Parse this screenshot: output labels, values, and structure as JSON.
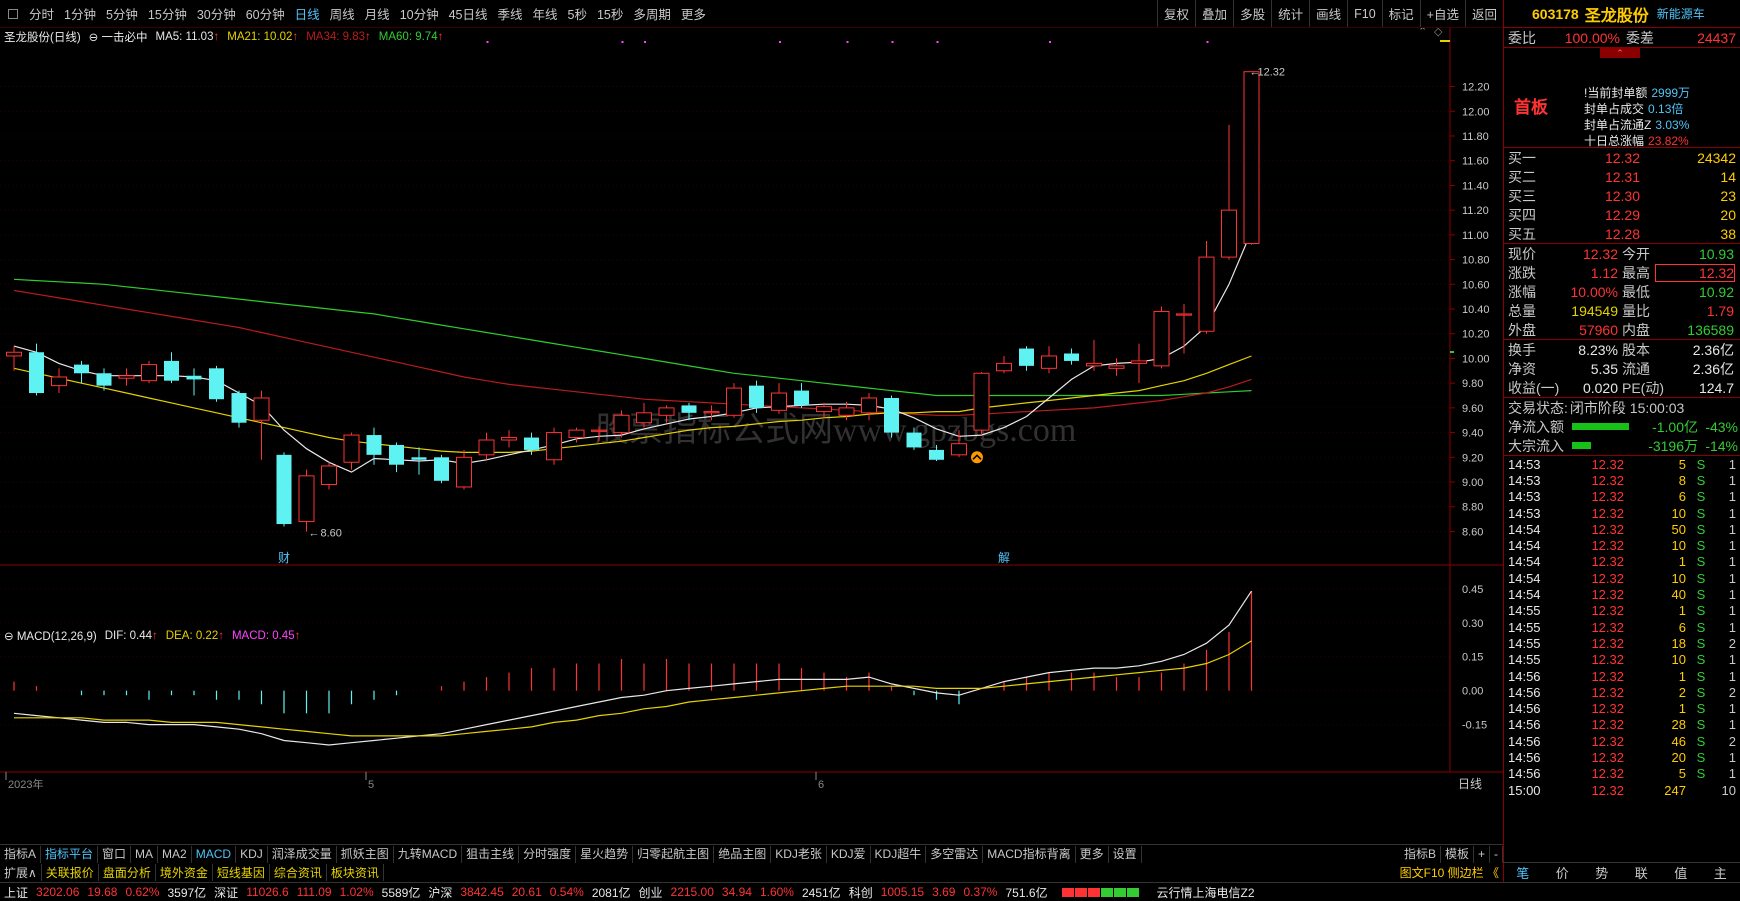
{
  "toolbar": {
    "timeframes": [
      "分时",
      "1分钟",
      "5分钟",
      "15分钟",
      "30分钟",
      "60分钟",
      "日线",
      "周线",
      "月线",
      "10分钟",
      "45日线",
      "季线",
      "年线",
      "5秒",
      "15秒",
      "多周期",
      "更多"
    ],
    "active_index": 6,
    "right_tools": [
      "复权",
      "叠加",
      "多股",
      "统计",
      "画线",
      "F10",
      "标记",
      "+自选",
      "返回"
    ]
  },
  "chart_info": {
    "title": "圣龙股份(日线)",
    "indicator": "一击必中",
    "ma5": "MA5: 11.03",
    "ma21": "MA21: 10.02",
    "ma34": "MA34: 9.83",
    "ma60": "MA60: 9.74"
  },
  "macd_info": {
    "title": "MACD(12,26,9)",
    "dif": "DIF: 0.44",
    "dea": "DEA: 0.22",
    "macd": "MACD: 0.45"
  },
  "chart_data": {
    "type": "candlestick",
    "price_axis": {
      "min": 8.45,
      "max": 12.35,
      "ticks": [
        8.6,
        8.8,
        9.0,
        9.2,
        9.4,
        9.6,
        9.8,
        10.0,
        10.2,
        10.4,
        10.6,
        10.8,
        11.0,
        11.2,
        11.4,
        11.6,
        11.8,
        12.0,
        12.2
      ]
    },
    "candles": [
      {
        "o": 10.02,
        "c": 10.05,
        "h": 10.1,
        "l": 9.9
      },
      {
        "o": 10.05,
        "c": 9.72,
        "h": 10.12,
        "l": 9.7
      },
      {
        "o": 9.78,
        "c": 9.85,
        "h": 9.92,
        "l": 9.72
      },
      {
        "o": 9.95,
        "c": 9.88,
        "h": 9.98,
        "l": 9.8
      },
      {
        "o": 9.88,
        "c": 9.78,
        "h": 9.92,
        "l": 9.74
      },
      {
        "o": 9.84,
        "c": 9.86,
        "h": 9.92,
        "l": 9.78
      },
      {
        "o": 9.82,
        "c": 9.95,
        "h": 9.98,
        "l": 9.8
      },
      {
        "o": 9.98,
        "c": 9.82,
        "h": 10.05,
        "l": 9.8
      },
      {
        "o": 9.86,
        "c": 9.83,
        "h": 9.92,
        "l": 9.7
      },
      {
        "o": 9.92,
        "c": 9.67,
        "h": 9.94,
        "l": 9.65
      },
      {
        "o": 9.72,
        "c": 9.48,
        "h": 9.74,
        "l": 9.44
      },
      {
        "o": 9.5,
        "c": 9.68,
        "h": 9.74,
        "l": 9.18
      },
      {
        "o": 9.22,
        "c": 8.66,
        "h": 9.24,
        "l": 8.64
      },
      {
        "o": 8.68,
        "c": 9.05,
        "h": 9.1,
        "l": 8.6
      },
      {
        "o": 8.98,
        "c": 9.13,
        "h": 9.16,
        "l": 8.94
      },
      {
        "o": 9.16,
        "c": 9.38,
        "h": 9.4,
        "l": 9.1
      },
      {
        "o": 9.38,
        "c": 9.22,
        "h": 9.44,
        "l": 9.14
      },
      {
        "o": 9.3,
        "c": 9.14,
        "h": 9.32,
        "l": 9.08
      },
      {
        "o": 9.2,
        "c": 9.18,
        "h": 9.28,
        "l": 9.06
      },
      {
        "o": 9.2,
        "c": 9.01,
        "h": 9.22,
        "l": 8.99
      },
      {
        "o": 8.96,
        "c": 9.2,
        "h": 9.26,
        "l": 8.94
      },
      {
        "o": 9.22,
        "c": 9.34,
        "h": 9.4,
        "l": 9.18
      },
      {
        "o": 9.34,
        "c": 9.36,
        "h": 9.42,
        "l": 9.28
      },
      {
        "o": 9.36,
        "c": 9.26,
        "h": 9.4,
        "l": 9.22
      },
      {
        "o": 9.18,
        "c": 9.4,
        "h": 9.44,
        "l": 9.14
      },
      {
        "o": 9.36,
        "c": 9.42,
        "h": 9.44,
        "l": 9.32
      },
      {
        "o": 9.42,
        "c": 9.42,
        "h": 9.45,
        "l": 9.33
      },
      {
        "o": 9.4,
        "c": 9.54,
        "h": 9.58,
        "l": 9.36
      },
      {
        "o": 9.48,
        "c": 9.56,
        "h": 9.64,
        "l": 9.44
      },
      {
        "o": 9.54,
        "c": 9.6,
        "h": 9.62,
        "l": 9.48
      },
      {
        "o": 9.62,
        "c": 9.56,
        "h": 9.64,
        "l": 9.5
      },
      {
        "o": 9.56,
        "c": 9.57,
        "h": 9.62,
        "l": 9.5
      },
      {
        "o": 9.54,
        "c": 9.76,
        "h": 9.8,
        "l": 9.52
      },
      {
        "o": 9.78,
        "c": 9.6,
        "h": 9.82,
        "l": 9.56
      },
      {
        "o": 9.58,
        "c": 9.72,
        "h": 9.8,
        "l": 9.55
      },
      {
        "o": 9.74,
        "c": 9.62,
        "h": 9.8,
        "l": 9.6
      },
      {
        "o": 9.57,
        "c": 9.61,
        "h": 9.64,
        "l": 9.52
      },
      {
        "o": 9.54,
        "c": 9.6,
        "h": 9.65,
        "l": 9.5
      },
      {
        "o": 9.56,
        "c": 9.68,
        "h": 9.72,
        "l": 9.5
      },
      {
        "o": 9.68,
        "c": 9.4,
        "h": 9.7,
        "l": 9.36
      },
      {
        "o": 9.4,
        "c": 9.28,
        "h": 9.44,
        "l": 9.26
      },
      {
        "o": 9.26,
        "c": 9.18,
        "h": 9.3,
        "l": 9.17
      },
      {
        "o": 9.22,
        "c": 9.31,
        "h": 9.42,
        "l": 9.2
      },
      {
        "o": 9.42,
        "c": 9.88,
        "h": 9.89,
        "l": 9.38
      },
      {
        "o": 9.9,
        "c": 9.96,
        "h": 10.02,
        "l": 9.88
      },
      {
        "o": 10.08,
        "c": 9.94,
        "h": 10.1,
        "l": 9.9
      },
      {
        "o": 9.92,
        "c": 10.02,
        "h": 10.1,
        "l": 9.88
      },
      {
        "o": 10.04,
        "c": 9.98,
        "h": 10.08,
        "l": 9.95
      },
      {
        "o": 9.94,
        "c": 9.96,
        "h": 10.15,
        "l": 9.9
      },
      {
        "o": 9.92,
        "c": 9.94,
        "h": 10.0,
        "l": 9.86
      },
      {
        "o": 9.96,
        "c": 9.98,
        "h": 10.12,
        "l": 9.8
      },
      {
        "o": 9.94,
        "c": 10.38,
        "h": 10.42,
        "l": 9.92
      },
      {
        "o": 10.36,
        "c": 10.36,
        "h": 10.44,
        "l": 10.04
      },
      {
        "o": 10.22,
        "c": 10.82,
        "h": 10.95,
        "l": 10.2
      },
      {
        "o": 10.82,
        "c": 11.2,
        "h": 11.89,
        "l": 10.8
      },
      {
        "o": 10.93,
        "c": 12.32,
        "h": 12.32,
        "l": 10.92
      }
    ],
    "ma5": [
      10.1,
      10.05,
      9.96,
      9.9,
      9.86,
      9.86,
      9.86,
      9.86,
      9.85,
      9.82,
      9.72,
      9.62,
      9.42,
      9.27,
      9.16,
      9.08,
      9.19,
      9.18,
      9.17,
      9.18,
      9.15,
      9.18,
      9.22,
      9.26,
      9.3,
      9.35,
      9.37,
      9.38,
      9.43,
      9.47,
      9.51,
      9.53,
      9.56,
      9.6,
      9.61,
      9.62,
      9.63,
      9.63,
      9.62,
      9.59,
      9.52,
      9.43,
      9.37,
      9.38,
      9.44,
      9.53,
      9.68,
      9.83,
      9.94,
      9.96,
      9.97,
      10.0,
      10.1,
      10.26,
      10.6,
      11.03
    ],
    "ma21": [
      9.92,
      9.88,
      9.84,
      9.8,
      9.76,
      9.72,
      9.68,
      9.64,
      9.6,
      9.56,
      9.52,
      9.48,
      9.44,
      9.4,
      9.36,
      9.33,
      9.31,
      9.29,
      9.27,
      9.25,
      9.24,
      9.24,
      9.24,
      9.25,
      9.27,
      9.29,
      9.31,
      9.33,
      9.36,
      9.39,
      9.42,
      9.44,
      9.45,
      9.47,
      9.49,
      9.5,
      9.52,
      9.53,
      9.55,
      9.56,
      9.56,
      9.57,
      9.57,
      9.6,
      9.62,
      9.64,
      9.66,
      9.68,
      9.7,
      9.72,
      9.74,
      9.78,
      9.82,
      9.88,
      9.95,
      10.02
    ],
    "ma34": [
      10.55,
      10.52,
      10.49,
      10.46,
      10.43,
      10.4,
      10.37,
      10.34,
      10.31,
      10.28,
      10.25,
      10.21,
      10.17,
      10.13,
      10.09,
      10.05,
      10.01,
      9.97,
      9.93,
      9.89,
      9.85,
      9.82,
      9.79,
      9.77,
      9.75,
      9.73,
      9.71,
      9.69,
      9.67,
      9.66,
      9.65,
      9.64,
      9.63,
      9.62,
      9.61,
      9.6,
      9.59,
      9.58,
      9.57,
      9.56,
      9.55,
      9.54,
      9.54,
      9.55,
      9.56,
      9.57,
      9.58,
      9.59,
      9.6,
      9.62,
      9.64,
      9.66,
      9.69,
      9.72,
      9.77,
      9.83
    ],
    "ma60": [
      10.64,
      10.63,
      10.62,
      10.61,
      10.6,
      10.58,
      10.56,
      10.54,
      10.52,
      10.5,
      10.48,
      10.46,
      10.44,
      10.42,
      10.4,
      10.38,
      10.36,
      10.33,
      10.3,
      10.27,
      10.24,
      10.21,
      10.18,
      10.15,
      10.12,
      10.09,
      10.06,
      10.03,
      10.0,
      9.97,
      9.94,
      9.91,
      9.88,
      9.86,
      9.84,
      9.82,
      9.8,
      9.78,
      9.76,
      9.74,
      9.72,
      9.7,
      9.7,
      9.7,
      9.7,
      9.7,
      9.7,
      9.7,
      9.7,
      9.7,
      9.7,
      9.7,
      9.71,
      9.72,
      9.73,
      9.74
    ],
    "macd_axis": {
      "min": -0.24,
      "max": 0.52,
      "ticks": [
        -0.15,
        0.0,
        0.15,
        0.3,
        0.45
      ]
    },
    "dif": [
      -0.1,
      -0.11,
      -0.12,
      -0.13,
      -0.14,
      -0.14,
      -0.15,
      -0.15,
      -0.15,
      -0.16,
      -0.17,
      -0.19,
      -0.22,
      -0.23,
      -0.24,
      -0.23,
      -0.22,
      -0.21,
      -0.2,
      -0.19,
      -0.17,
      -0.15,
      -0.13,
      -0.11,
      -0.09,
      -0.07,
      -0.05,
      -0.03,
      -0.02,
      0.0,
      0.01,
      0.02,
      0.03,
      0.04,
      0.05,
      0.05,
      0.05,
      0.05,
      0.06,
      0.03,
      0.01,
      -0.01,
      -0.02,
      0.01,
      0.04,
      0.06,
      0.08,
      0.09,
      0.1,
      0.1,
      0.11,
      0.13,
      0.16,
      0.21,
      0.29,
      0.44
    ],
    "dea": [
      -0.12,
      -0.12,
      -0.12,
      -0.12,
      -0.13,
      -0.13,
      -0.13,
      -0.14,
      -0.14,
      -0.14,
      -0.15,
      -0.16,
      -0.17,
      -0.18,
      -0.19,
      -0.2,
      -0.2,
      -0.2,
      -0.2,
      -0.2,
      -0.19,
      -0.18,
      -0.17,
      -0.16,
      -0.14,
      -0.13,
      -0.11,
      -0.1,
      -0.08,
      -0.07,
      -0.05,
      -0.04,
      -0.03,
      -0.02,
      -0.01,
      0.0,
      0.01,
      0.02,
      0.02,
      0.02,
      0.02,
      0.01,
      0.01,
      0.01,
      0.02,
      0.03,
      0.04,
      0.05,
      0.06,
      0.07,
      0.08,
      0.09,
      0.1,
      0.12,
      0.16,
      0.22
    ],
    "bottom_labels": [
      {
        "i": 0,
        "text": "2023年"
      },
      {
        "i": 16,
        "text": "5"
      },
      {
        "i": 36,
        "text": "6"
      }
    ],
    "annotations": {
      "high_label": "12.32",
      "low_label": "8.60",
      "mark_cai": "财",
      "mark_jie": "解"
    }
  },
  "tabs": {
    "left": "指标A",
    "items": [
      "指标平台",
      "窗口",
      "MA",
      "MA2",
      "MACD",
      "KDJ",
      "润泽成交量",
      "抓妖主图",
      "九转MACD",
      "狙击主线",
      "分时强度",
      "星火趋势",
      "归零起航主图",
      "绝品主图",
      "KDJ老张",
      "KDJ爱",
      "KDJ超牛",
      "多空雷达",
      "MACD指标背离",
      "更多",
      "设置"
    ],
    "active_indices": [
      0,
      4
    ],
    "right": [
      "指标B",
      "模板",
      "+",
      "-"
    ]
  },
  "tabs2": {
    "items": [
      "扩展∧",
      "关联报价",
      "盘面分析",
      "境外资金",
      "短线基因",
      "综合资讯",
      "板块资讯"
    ],
    "timeframe": "日线",
    "side_label": "图文F10 侧边栏 《"
  },
  "status": {
    "sh": [
      "上证",
      "3202.06",
      "19.68",
      "0.62%",
      "3597亿"
    ],
    "sz": [
      "深证",
      "11026.6",
      "111.09",
      "1.02%",
      "5589亿"
    ],
    "hs": [
      "沪深",
      "3842.45",
      "20.61",
      "0.54%",
      "2081亿"
    ],
    "cy": [
      "创业",
      "2215.00",
      "34.94",
      "1.60%",
      "2451亿"
    ],
    "kc": [
      "科创",
      "1005.15",
      "3.69",
      "0.37%",
      "751.6亿"
    ],
    "server": "云行情上海电信Z2"
  },
  "side": {
    "code": "603178",
    "name": "圣龙股份",
    "tag": "新能源车",
    "weibi_label": "委比",
    "weibi": "100.00%",
    "weicha_label": "委差",
    "weicha": "24437",
    "shouban": "首板",
    "seal": [
      {
        "k": "!当前封单额",
        "v": "2999万"
      },
      {
        "k": "封单占成交",
        "v": "0.13倍"
      },
      {
        "k": "封单占流通Z",
        "v": "3.03%"
      },
      {
        "k": "十日总涨幅",
        "v": "23.82%"
      }
    ],
    "bids": [
      {
        "l": "买一",
        "p": "12.32",
        "v": "24342"
      },
      {
        "l": "买二",
        "p": "12.31",
        "v": "14"
      },
      {
        "l": "买三",
        "p": "12.30",
        "v": "23"
      },
      {
        "l": "买四",
        "p": "12.29",
        "v": "20"
      },
      {
        "l": "买五",
        "p": "12.28",
        "v": "38"
      }
    ],
    "quote": [
      {
        "l1": "现价",
        "v1": "12.32",
        "l2": "今开",
        "v2": "10.93"
      },
      {
        "l1": "涨跌",
        "v1": "1.12",
        "l2": "最高",
        "v2": "12.32"
      },
      {
        "l1": "涨幅",
        "v1": "10.00%",
        "l2": "最低",
        "v2": "10.92"
      },
      {
        "l1": "总量",
        "v1": "194549",
        "l2": "量比",
        "v2": "1.79"
      },
      {
        "l1": "外盘",
        "v1": "57960",
        "l2": "内盘",
        "v2": "136589"
      }
    ],
    "quote2": [
      {
        "l1": "换手",
        "v1": "8.23%",
        "l2": "股本",
        "v2": "2.36亿"
      },
      {
        "l1": "净资",
        "v1": "5.35",
        "l2": "流通",
        "v2": "2.36亿"
      },
      {
        "l1": "收益(一)",
        "v1": "0.020",
        "l2": "PE(动)",
        "v2": "124.7"
      }
    ],
    "trade_state_label": "交易状态:",
    "trade_state": "闭市阶段 15:00:03",
    "flow": [
      {
        "k": "净流入额",
        "v": "-1.00亿",
        "p": "-43%",
        "bar": 0.43
      },
      {
        "k": "大宗流入",
        "v": "-3196万",
        "p": "-14%",
        "bar": 0.14
      }
    ],
    "ticks": [
      {
        "t": "14:53",
        "p": "12.32",
        "v": "5",
        "s": "S",
        "n": "1"
      },
      {
        "t": "14:53",
        "p": "12.32",
        "v": "8",
        "s": "S",
        "n": "1"
      },
      {
        "t": "14:53",
        "p": "12.32",
        "v": "6",
        "s": "S",
        "n": "1"
      },
      {
        "t": "14:53",
        "p": "12.32",
        "v": "10",
        "s": "S",
        "n": "1"
      },
      {
        "t": "14:54",
        "p": "12.32",
        "v": "50",
        "s": "S",
        "n": "1"
      },
      {
        "t": "14:54",
        "p": "12.32",
        "v": "10",
        "s": "S",
        "n": "1"
      },
      {
        "t": "14:54",
        "p": "12.32",
        "v": "1",
        "s": "S",
        "n": "1"
      },
      {
        "t": "14:54",
        "p": "12.32",
        "v": "10",
        "s": "S",
        "n": "1"
      },
      {
        "t": "14:54",
        "p": "12.32",
        "v": "40",
        "s": "S",
        "n": "1"
      },
      {
        "t": "14:55",
        "p": "12.32",
        "v": "1",
        "s": "S",
        "n": "1"
      },
      {
        "t": "14:55",
        "p": "12.32",
        "v": "6",
        "s": "S",
        "n": "1"
      },
      {
        "t": "14:55",
        "p": "12.32",
        "v": "18",
        "s": "S",
        "n": "2"
      },
      {
        "t": "14:55",
        "p": "12.32",
        "v": "10",
        "s": "S",
        "n": "1"
      },
      {
        "t": "14:56",
        "p": "12.32",
        "v": "1",
        "s": "S",
        "n": "1"
      },
      {
        "t": "14:56",
        "p": "12.32",
        "v": "2",
        "s": "S",
        "n": "2"
      },
      {
        "t": "14:56",
        "p": "12.32",
        "v": "1",
        "s": "S",
        "n": "1"
      },
      {
        "t": "14:56",
        "p": "12.32",
        "v": "28",
        "s": "S",
        "n": "1"
      },
      {
        "t": "14:56",
        "p": "12.32",
        "v": "46",
        "s": "S",
        "n": "2"
      },
      {
        "t": "14:56",
        "p": "12.32",
        "v": "20",
        "s": "S",
        "n": "1"
      },
      {
        "t": "14:56",
        "p": "12.32",
        "v": "5",
        "s": "S",
        "n": "1"
      },
      {
        "t": "15:00",
        "p": "12.32",
        "v": "247",
        "s": "",
        "n": "10"
      }
    ],
    "bottom_tabs": [
      "笔",
      "价",
      "势",
      "联",
      "值",
      "主"
    ]
  },
  "watermark": "股票指标公式网www.gpzbgs.com",
  "colors": {
    "up": "#ff3333",
    "down": "#5ff2f2",
    "ma5": "#e8e8e8",
    "ma21": "#e6d200",
    "ma34": "#b81c1c",
    "ma60": "#2ecc2e"
  }
}
